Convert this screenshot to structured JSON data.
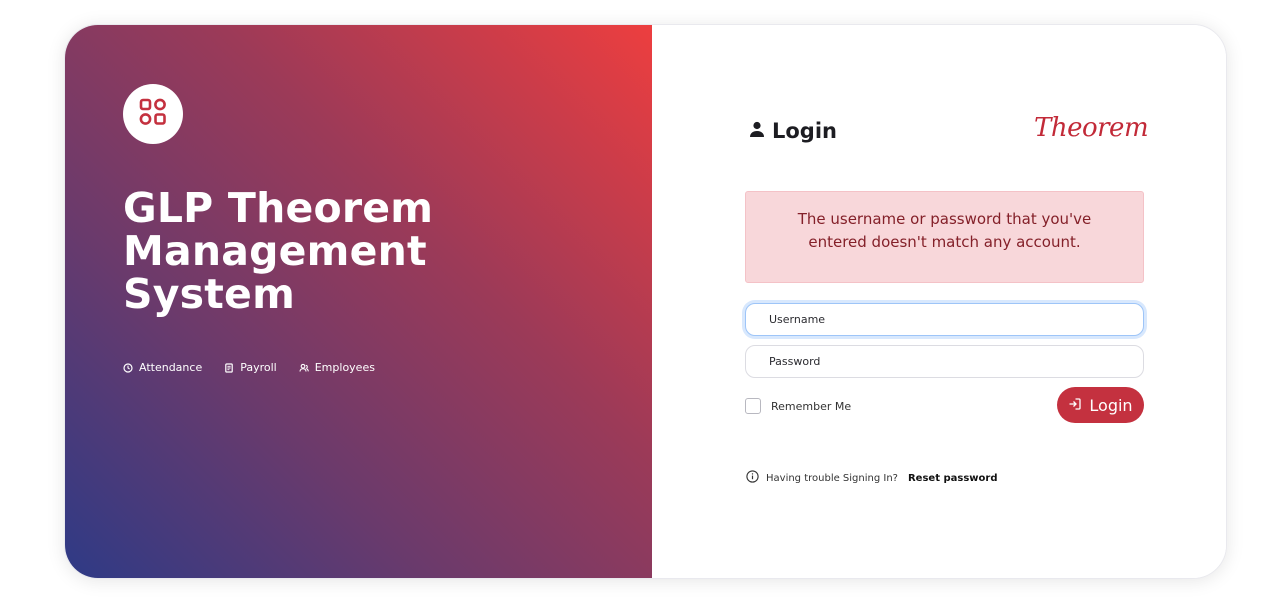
{
  "brand": {
    "logo_icon": "grid-shapes-icon",
    "title_lines": [
      "GLP Theorem",
      "Management",
      "System"
    ]
  },
  "features": [
    {
      "icon": "clock-icon",
      "label": "Attendance"
    },
    {
      "icon": "receipt-icon",
      "label": "Payroll"
    },
    {
      "icon": "users-icon",
      "label": "Employees"
    }
  ],
  "login": {
    "heading": "Login",
    "heading_icon": "user-icon",
    "partner_logo": "Theorem",
    "error_message": "The username or password that you've entered doesn't match any account.",
    "username_placeholder": "Username",
    "password_placeholder": "Password",
    "remember_label": "Remember Me",
    "button_label": "Login",
    "button_icon": "sign-in-icon",
    "trouble_text": "Having trouble Signing In?",
    "reset_link": "Reset password"
  },
  "colors": {
    "gradient_start": "#2e3a86",
    "gradient_end": "#ed3e3f",
    "accent": "#c4313f",
    "alert_bg": "#f8d7da",
    "alert_text": "#842029"
  }
}
